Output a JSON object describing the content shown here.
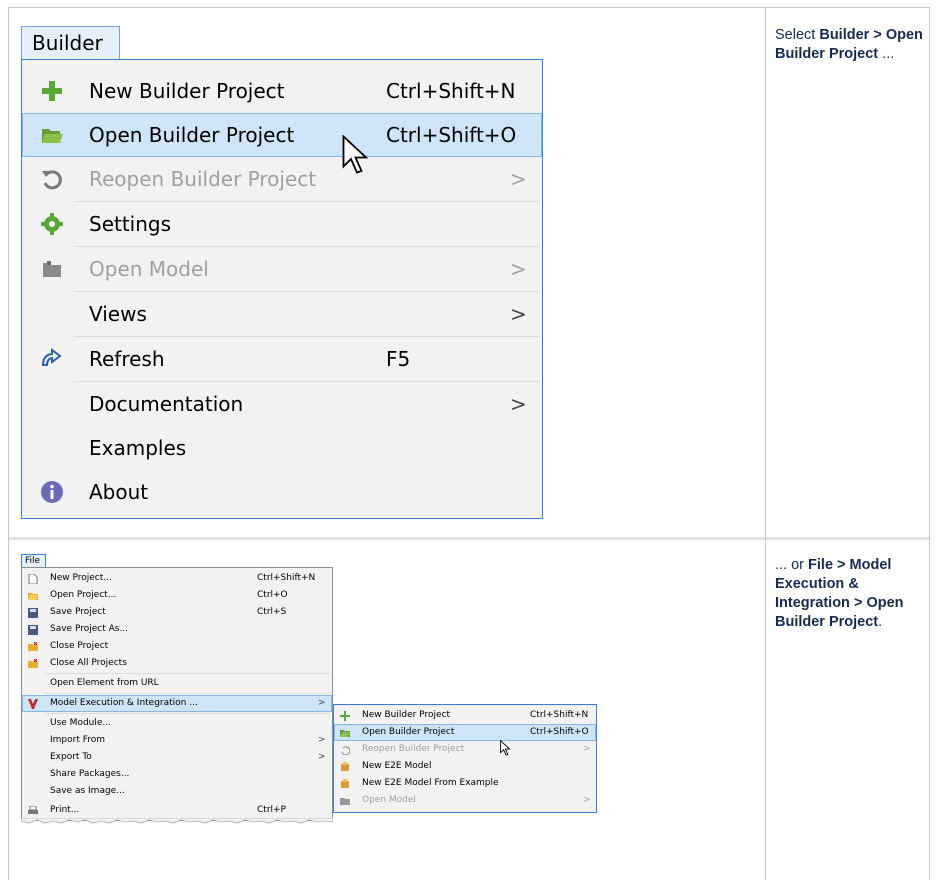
{
  "builder_menu": {
    "title": "Builder",
    "items": [
      {
        "label": "New Builder Project",
        "shortcut": "Ctrl+Shift+N",
        "icon": "plus-icon",
        "disabled": false,
        "submenu": false
      },
      {
        "label": "Open Builder Project",
        "shortcut": "Ctrl+Shift+O",
        "icon": "open-folder-icon",
        "disabled": false,
        "submenu": false,
        "highlighted": true
      },
      {
        "label": "Reopen Builder Project",
        "shortcut": "",
        "icon": "reopen-icon",
        "disabled": true,
        "submenu": true
      },
      {
        "label": "Settings",
        "shortcut": "",
        "icon": "gear-icon",
        "disabled": false,
        "submenu": false
      },
      {
        "label": "Open Model",
        "shortcut": "",
        "icon": "model-icon",
        "disabled": true,
        "submenu": true
      },
      {
        "label": "Views",
        "shortcut": "",
        "icon": "",
        "disabled": false,
        "submenu": true
      },
      {
        "label": "Refresh",
        "shortcut": "F5",
        "icon": "refresh-icon",
        "disabled": false,
        "submenu": false
      },
      {
        "label": "Documentation",
        "shortcut": "",
        "icon": "",
        "disabled": false,
        "submenu": true
      },
      {
        "label": "Examples",
        "shortcut": "",
        "icon": "",
        "disabled": false,
        "submenu": false
      },
      {
        "label": "About",
        "shortcut": "",
        "icon": "info-icon",
        "disabled": false,
        "submenu": false
      }
    ],
    "arrow": ">"
  },
  "desc1": {
    "prefix": "Select ",
    "bold": "Builder > Open Builder Project",
    "suffix": " ..."
  },
  "desc2": {
    "prefix": "... or ",
    "bold": "File > Model Execution & Integration > Open Builder Project",
    "suffix": "."
  },
  "file_menu": {
    "title": "File",
    "items": [
      {
        "label": "New Project...",
        "shortcut": "Ctrl+Shift+N"
      },
      {
        "label": "Open Project...",
        "shortcut": "Ctrl+O"
      },
      {
        "label": "Save Project",
        "shortcut": "Ctrl+S"
      },
      {
        "label": "Save Project As...",
        "shortcut": ""
      },
      {
        "label": "Close Project",
        "shortcut": ""
      },
      {
        "label": "Close All Projects",
        "shortcut": ""
      },
      {
        "label": "Open Element from URL",
        "shortcut": ""
      },
      {
        "label": "Model Execution & Integration ...",
        "shortcut": ""
      },
      {
        "label": "Use Module...",
        "shortcut": ""
      },
      {
        "label": "Import From",
        "shortcut": ""
      },
      {
        "label": "Export To",
        "shortcut": ""
      },
      {
        "label": "Share Packages...",
        "shortcut": ""
      },
      {
        "label": "Save as Image...",
        "shortcut": ""
      },
      {
        "label": "Print...",
        "shortcut": "Ctrl+P"
      }
    ]
  },
  "sub_menu": {
    "items": [
      {
        "label": "New Builder Project",
        "shortcut": "Ctrl+Shift+N"
      },
      {
        "label": "Open Builder Project",
        "shortcut": "Ctrl+Shift+O"
      },
      {
        "label": "Reopen Builder Project",
        "shortcut": ""
      },
      {
        "label": "New E2E Model",
        "shortcut": ""
      },
      {
        "label": "New E2E Model From Example",
        "shortcut": ""
      },
      {
        "label": "Open Model",
        "shortcut": ""
      }
    ]
  },
  "colors": {
    "highlight": "#cfe4f7",
    "border": "#3a7dd6",
    "green": "#5aa83a",
    "gray": "#8a8a8a"
  }
}
